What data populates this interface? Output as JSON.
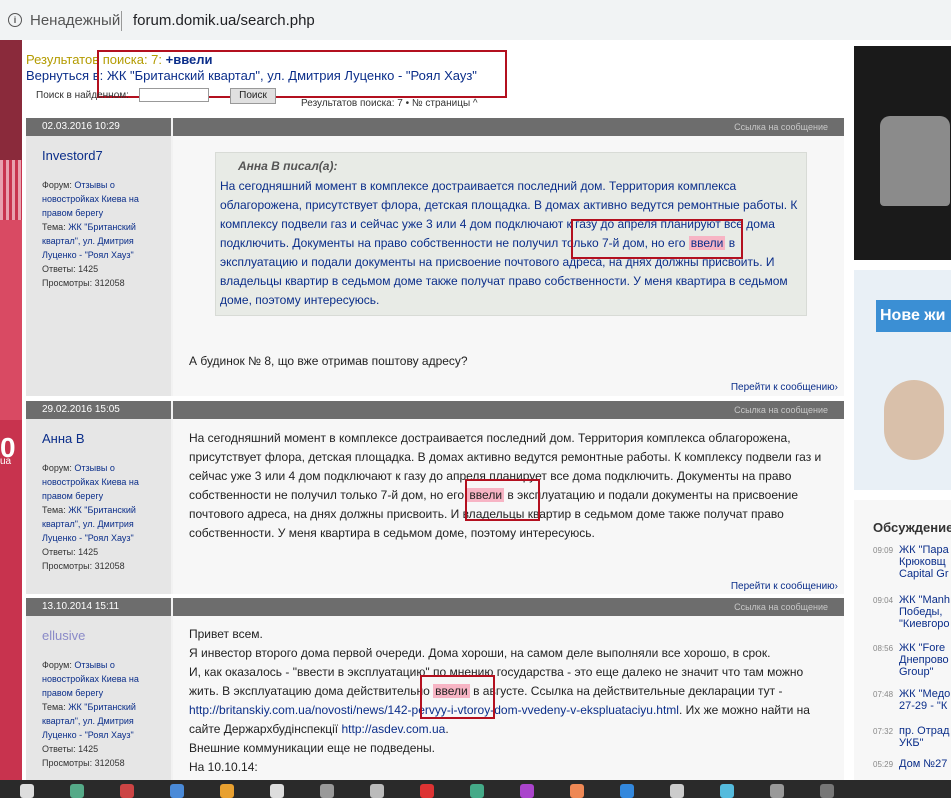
{
  "browser": {
    "security_label": "Ненадежный",
    "url": "forum.domik.ua/search.php"
  },
  "search": {
    "results_label": "Результатов поиска: 7:",
    "term": "+ввели",
    "back_text": "Вернуться в: ЖК \"Британский квартал\", ул. Дмитрия Луценко - \"Роял Хауз\"",
    "find_label": "Поиск в найденном:",
    "find_button": "Поиск",
    "pager": "Результатов поиска: 7 • № страницы ^"
  },
  "posts": [
    {
      "date": "02.03.2016 10:29",
      "link": "Ссылка на сообщение",
      "user": "Investord7",
      "forum_label": "Форум:",
      "forum": "Отзывы о новостройках Киева на правом берегу",
      "topic_label": "Тема:",
      "topic": "ЖК \"Британский квартал\", ул. Дмитрия Луценко - \"Роял Хауз\"",
      "replies": "Ответы: 1425",
      "views": "Просмотры: 312058",
      "quote_author": "Анна В писал(а):",
      "quote_lines": [
        "На сегодняшний момент в комплексе достраивается последний дом. Территория комплекса",
        "облагорожена, присутствует флора, детская площадка. В домах активно ведутся ремонтные работы. К",
        "комплексу подвели газ и сейчас уже 3 или 4 дом подключают к газу до апреля планируют все дома",
        "подключить. Документы на право собственности не получил только 7-й дом, но его",
        "эксплуатацию и подали документы на присвоение почтового адреса, на днях должны присвоить. И",
        "владельцы квартир в седьмом доме также получат право собственности. У меня квартира в седьмом",
        "доме, поэтому интересуюсь."
      ],
      "highlight": "ввели",
      "after_highlight": "в",
      "reply_text": "А будинок № 8, що вже отримав поштову адресу?",
      "goto": "Перейти к сообщению›"
    },
    {
      "date": "29.02.2016 15:05",
      "link": "Ссылка на сообщение",
      "user": "Анна В",
      "forum_label": "Форум:",
      "forum": "Отзывы о новостройках Киева на правом берегу",
      "topic_label": "Тема:",
      "topic": "ЖК \"Британский квартал\", ул. Дмитрия Луценко - \"Роял Хауз\"",
      "replies": "Ответы: 1425",
      "views": "Просмотры: 312058",
      "lines": [
        "На сегодняшний момент в комплексе достраивается последний дом. Территория комплекса облагорожена,",
        "присутствует флора, детская площадка. В домах активно ведутся ремонтные работы. К комплексу подвели газ и",
        "сейчас уже 3 или 4 дом подключают к газу до апреля планирует все дома подключить. Документы на право",
        "собственности не получил только 7-й дом, но его",
        "почтового адреса, на днях должны присвоить. И владельцы квартир в седьмом доме также получат право",
        "собственности. У меня квартира в седьмом доме, поэтому интересуюсь."
      ],
      "highlight": "ввели",
      "after_highlight": "в эксплуатацию и подали документы на присвоение",
      "goto": "Перейти к сообщению›"
    },
    {
      "date": "13.10.2014 15:11",
      "link": "Ссылка на сообщение",
      "user": "ellusive",
      "forum_label": "Форум:",
      "forum": "Отзывы о новостройках Киева на правом берегу",
      "topic_label": "Тема:",
      "topic": "ЖК \"Британский квартал\", ул. Дмитрия Луценко - \"Роял Хауз\"",
      "replies": "Ответы: 1425",
      "views": "Просмотры: 312058",
      "line1": "Привет всем.",
      "line2": "Я инвестор второго дома первой очереди. Дома хороши, на самом деле выполняли все хорошо, в срок.",
      "line3": "И, как оказалось - \"ввести в эксплуатацию\" по мнению государства - это еще далеко не значит что там можно",
      "line4_before": "жить. В эксплуатацию дома действительно",
      "highlight": "ввели",
      "line4_after": "в августе. Ссылка на действительные декларации тут -",
      "link1": "http://britanskiy.com.ua/novosti/news/142-pervyy-i-vtoroy-dom-vvedeny-v-ekspluataciyu.html",
      "line5_after": ". Их же можно найти на",
      "line6_before": "сайте Держархбудінспекції",
      "link2": "http://asdev.com.ua",
      "line6_after": ".",
      "line7": "Внешние коммуникации еще не подведены.",
      "line8": "На 10.10.14:"
    }
  ],
  "sidebar": {
    "ad_text": "Нове жи",
    "left_ad_big": "0",
    "left_ad_small": "ua",
    "discussions_title": "Обсуждение",
    "items": [
      {
        "time": "09:09",
        "text": "ЖК \"Пара\nКрюковщ\nCapital Gr"
      },
      {
        "time": "09:04",
        "text": "ЖК \"Manh\nПобеды,\n\"Киевгоро"
      },
      {
        "time": "08:56",
        "text": "ЖК \"Fore\nДнепрово\nGroup\""
      },
      {
        "time": "07:48",
        "text": "ЖК \"Медо\n27-29 - \"К"
      },
      {
        "time": "07:32",
        "text": "пр. Отрад\nУКБ\""
      },
      {
        "time": "05:29",
        "text": "Дом №27"
      }
    ]
  },
  "colors": {
    "accent_blue": "#0b2e8a",
    "highlight": "#f7b4c4",
    "annotation_red": "#b3101f",
    "header_gray": "#6d6d6d"
  }
}
